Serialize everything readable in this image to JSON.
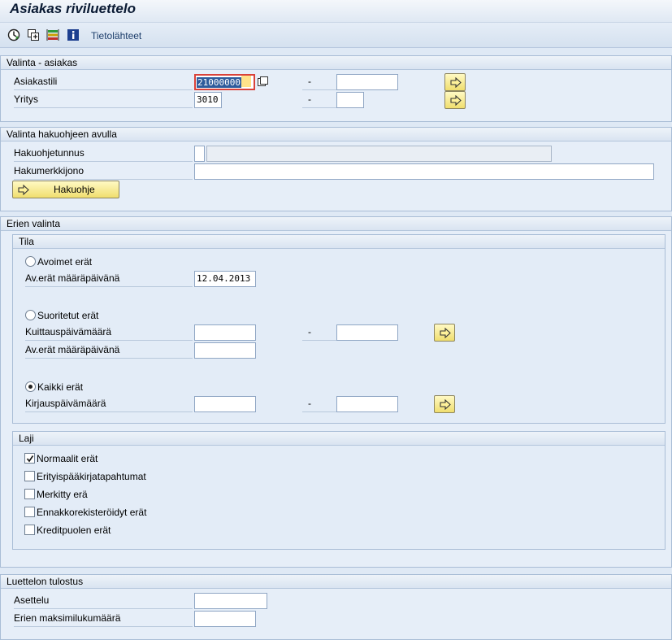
{
  "app": {
    "title": "Asiakas riviluettelo"
  },
  "toolbar": {
    "datasources_label": "Tietolähteet"
  },
  "customer": {
    "heading": "Valinta - asiakas",
    "account_label": "Asiakastili",
    "account_from": "21000000",
    "account_to": "",
    "company_label": "Yritys",
    "company_from": "3010",
    "company_to": "",
    "dash": "-"
  },
  "search": {
    "heading": "Valinta hakuohjeen avulla",
    "id_label": "Hakuohjetunnus",
    "id_value": "",
    "id_desc": "",
    "string_label": "Hakumerkkijono",
    "string_value": "",
    "button_label": "Hakuohje"
  },
  "items": {
    "heading": "Erien valinta",
    "status": {
      "heading": "Tila",
      "open_label": "Avoimet erät",
      "open_keydate_label": "Av.erät määräpäivänä",
      "open_keydate_value": "12.04.2013",
      "cleared_label": "Suoritetut erät",
      "clearing_date_label": "Kuittauspäivämäärä",
      "clearing_date_from": "",
      "clearing_date_to": "",
      "cleared_keydate_label": "Av.erät määräpäivänä",
      "cleared_keydate_value": "",
      "all_label": "Kaikki erät",
      "posting_date_label": "Kirjauspäivämäärä",
      "posting_date_from": "",
      "posting_date_to": "",
      "selected": "all",
      "dash": "-"
    },
    "type": {
      "heading": "Laji",
      "options": [
        {
          "label": "Normaalit erät",
          "checked": true
        },
        {
          "label": "Erityispääkirjatapahtumat",
          "checked": false
        },
        {
          "label": "Merkitty erä",
          "checked": false
        },
        {
          "label": "Ennakkorekisteröidyt erät",
          "checked": false
        },
        {
          "label": "Kreditpuolen erät",
          "checked": false
        }
      ]
    }
  },
  "output": {
    "heading": "Luettelon tulostus",
    "layout_label": "Asettelu",
    "layout_value": "",
    "max_items_label": "Erien maksimilukumäärä",
    "max_items_value": ""
  }
}
